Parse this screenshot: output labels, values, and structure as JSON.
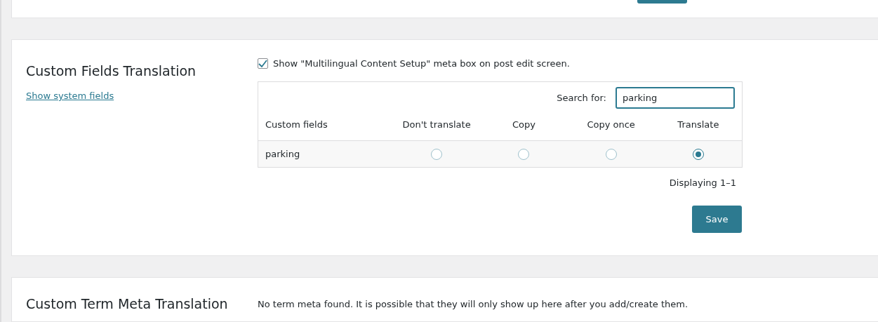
{
  "custom_fields_translation": {
    "title": "Custom Fields Translation",
    "link": "Show system fields",
    "checkbox": {
      "label": "Show \"Multilingual Content Setup\" meta box on post edit screen.",
      "checked": true
    },
    "search": {
      "label": "Search for:",
      "value": "parking"
    },
    "columns": [
      "Custom fields",
      "Don't translate",
      "Copy",
      "Copy once",
      "Translate"
    ],
    "rows": [
      {
        "name": "parking",
        "options": [
          {
            "selected": false
          },
          {
            "selected": false
          },
          {
            "selected": false
          },
          {
            "selected": true
          }
        ]
      }
    ],
    "pagination": "Displaying 1–1",
    "save": "Save"
  },
  "custom_term_meta_translation": {
    "title": "Custom Term Meta Translation",
    "message": "No term meta found. It is possible that they will only show up here after you add/create them."
  }
}
